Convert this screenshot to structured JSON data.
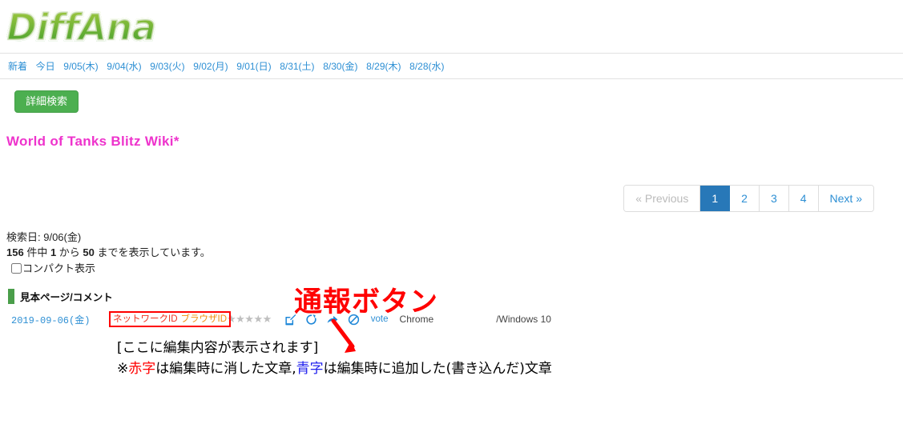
{
  "site": {
    "logo_text": "DiffAna"
  },
  "daynav": {
    "items": [
      {
        "label": "新着",
        "name": "nav-new"
      },
      {
        "label": "今日",
        "name": "nav-today"
      },
      {
        "label": "9/05(木)",
        "name": "nav-0905"
      },
      {
        "label": "9/04(水)",
        "name": "nav-0904"
      },
      {
        "label": "9/03(火)",
        "name": "nav-0903"
      },
      {
        "label": "9/02(月)",
        "name": "nav-0902"
      },
      {
        "label": "9/01(日)",
        "name": "nav-0901"
      },
      {
        "label": "8/31(土)",
        "name": "nav-0831"
      },
      {
        "label": "8/30(金)",
        "name": "nav-0830"
      },
      {
        "label": "8/29(木)",
        "name": "nav-0829"
      },
      {
        "label": "8/28(水)",
        "name": "nav-0828"
      }
    ]
  },
  "toolbar": {
    "search_label": "詳細検索"
  },
  "page": {
    "title": "World of Tanks Blitz Wiki*",
    "title_color": "#ee33cc"
  },
  "pagination": {
    "previous_label": "« Previous",
    "next_label": "Next »",
    "pages": [
      "1",
      "2",
      "3",
      "4"
    ],
    "active_page": "1",
    "active_color": "#2878b8"
  },
  "info": {
    "search_date_label": "検索日: 9/06(金)",
    "result_total": "156",
    "result_prefix": " 件中 ",
    "result_from": "1",
    "result_middle": " から ",
    "result_to": "50",
    "result_suffix": " までを表示しています。",
    "compact_label": "コンパクト表示",
    "compact_checked": false
  },
  "section": {
    "label": "見本ページ/コメント",
    "bar_color": "#4a9e4a"
  },
  "entry": {
    "date": "2019-09-06(金)",
    "network_id_label": "ネットワークID",
    "browser_id_label": "ブラウザID",
    "network_id_color": "#ee3322",
    "browser_id_color": "#f0900f",
    "highlight_box_color": "#ff0000",
    "stars": "★★★★★",
    "star_color": "#bfbfbf",
    "icons": [
      {
        "name": "edit-icon",
        "title": "編集"
      },
      {
        "name": "refresh-icon",
        "title": "更新"
      },
      {
        "name": "share-icon",
        "title": "共有"
      },
      {
        "name": "report-ban-icon",
        "title": "通報"
      }
    ],
    "vote_label": "vote",
    "browser": "Chrome",
    "os": "/Windows 10"
  },
  "annotation": {
    "report_button_text": "通報ボタン",
    "color": "#ff0000"
  },
  "note": {
    "line1": "[ここに編集内容が表示されます]",
    "line2_p1": "※",
    "line2_red": "赤字",
    "line2_p2": "は編集時に消した文章,",
    "line2_blue": "青字",
    "line2_p3": "は編集時に追加した(書き込んだ)文章"
  }
}
